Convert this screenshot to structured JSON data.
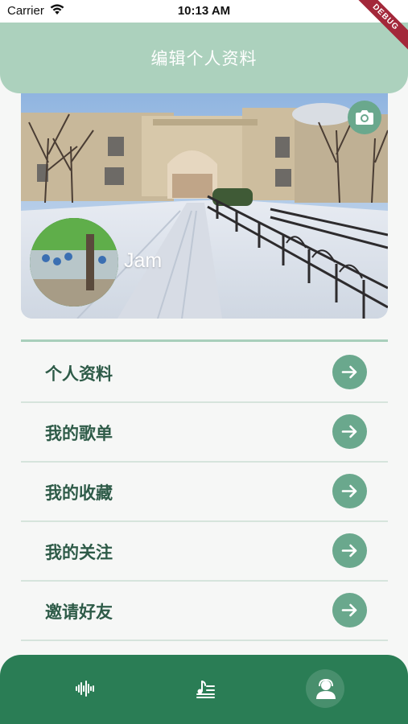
{
  "status_bar": {
    "carrier": "Carrier",
    "time": "10:13 AM",
    "debug_banner": "DEBUG"
  },
  "app_bar": {
    "title": "编辑个人资料"
  },
  "profile": {
    "username": "Jam",
    "camera_icon": "camera-icon"
  },
  "menu": {
    "items": [
      {
        "label": "个人资料",
        "icon": "arrow-right-icon"
      },
      {
        "label": "我的歌单",
        "icon": "arrow-right-icon"
      },
      {
        "label": "我的收藏",
        "icon": "arrow-right-icon"
      },
      {
        "label": "我的关注",
        "icon": "arrow-right-icon"
      },
      {
        "label": "邀请好友",
        "icon": "arrow-right-icon"
      }
    ]
  },
  "bottom_nav": {
    "items": [
      {
        "icon": "audio-wave-icon",
        "active": false
      },
      {
        "icon": "music-list-icon",
        "active": false
      },
      {
        "icon": "user-profile-icon",
        "active": true
      }
    ]
  },
  "colors": {
    "app_bar": "#acd1bd",
    "accent": "#6aa88d",
    "menu_text": "#2e5b48",
    "bottom_nav": "#2a7d55",
    "debug": "#a3283a"
  }
}
